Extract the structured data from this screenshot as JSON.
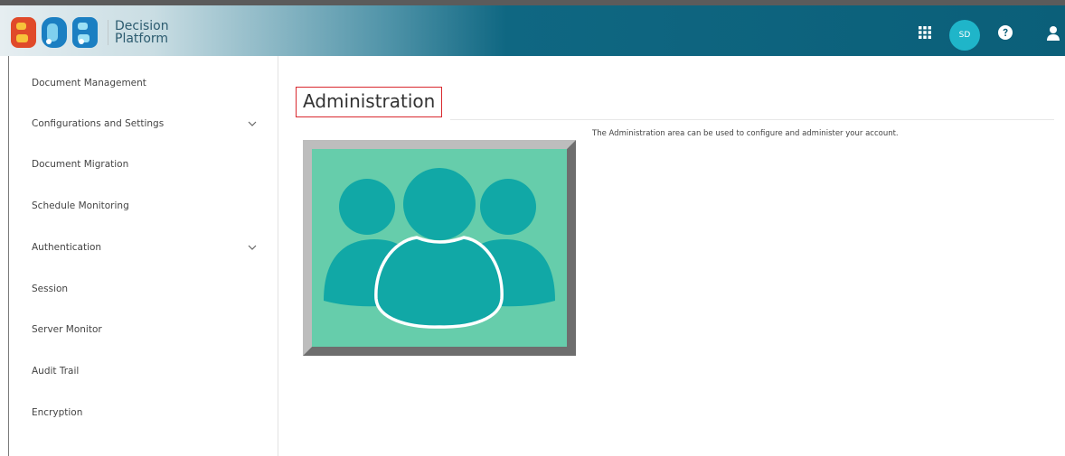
{
  "header": {
    "brand_line1": "Decision",
    "brand_line2": "Platform",
    "avatar_initials": "SD",
    "colors": {
      "bar": "#0b5f79",
      "avatar": "#1fb5c9"
    },
    "icons": [
      "apps-grid-icon",
      "help-icon",
      "user-icon"
    ]
  },
  "sidebar": {
    "items": [
      {
        "label": "Document Management",
        "has_chevron": false
      },
      {
        "label": "Configurations and Settings",
        "has_chevron": true
      },
      {
        "label": "Document Migration",
        "has_chevron": false
      },
      {
        "label": "Schedule Monitoring",
        "has_chevron": false
      },
      {
        "label": "Authentication",
        "has_chevron": true
      },
      {
        "label": "Session",
        "has_chevron": false
      },
      {
        "label": "Server Monitor",
        "has_chevron": false
      },
      {
        "label": "Audit Trail",
        "has_chevron": false
      },
      {
        "label": "Encryption",
        "has_chevron": false
      }
    ]
  },
  "main": {
    "title": "Administration",
    "description": "The Administration area can be used to configure and administer your account.",
    "tile_icon": "users-group-icon",
    "colors": {
      "tile_bg": "#66cdab",
      "tile_figures": "#11a8a6",
      "title_border": "#d9292f"
    }
  }
}
